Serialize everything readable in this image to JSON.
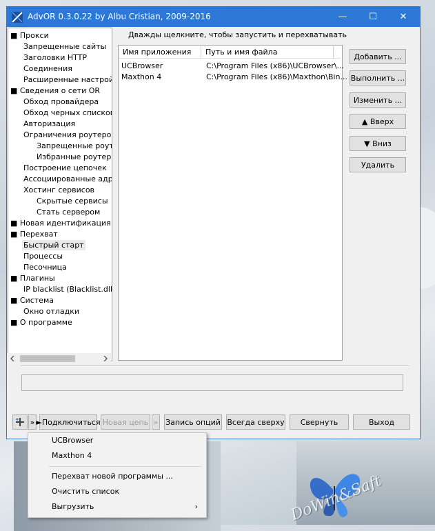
{
  "window": {
    "title": "AdvOR  0.3.0.22 by Albu Cristian, 2009-2016",
    "minimize": "—",
    "maximize": "☐",
    "close": "✕"
  },
  "tree": {
    "items": [
      {
        "label": "■ Прокси",
        "level": 0
      },
      {
        "label": "Запрещенные сайты",
        "level": 1
      },
      {
        "label": "Заголовки HTTP",
        "level": 1
      },
      {
        "label": "Соединения",
        "level": 1
      },
      {
        "label": "Расширенные настройки",
        "level": 1
      },
      {
        "label": "■ Сведения о сети OR",
        "level": 0
      },
      {
        "label": "Обход провайдера",
        "level": 1
      },
      {
        "label": "Обход черных списков T",
        "level": 1
      },
      {
        "label": "Авторизация",
        "level": 1
      },
      {
        "label": "Ограничения роутеров",
        "level": 1
      },
      {
        "label": "Запрещенные роутеры",
        "level": 2
      },
      {
        "label": "Избранные роутеры",
        "level": 2
      },
      {
        "label": "Построение цепочек",
        "level": 1
      },
      {
        "label": "Ассоциированные адреса",
        "level": 1
      },
      {
        "label": "Хостинг сервисов",
        "level": 1
      },
      {
        "label": "Скрытые сервисы",
        "level": 2
      },
      {
        "label": "Стать сервером",
        "level": 2
      },
      {
        "label": "■ Новая идентификация",
        "level": 0
      },
      {
        "label": "■ Перехват",
        "level": 0
      },
      {
        "label": "Быстрый старт",
        "level": 1,
        "selected": true
      },
      {
        "label": "Процессы",
        "level": 1
      },
      {
        "label": "Песочница",
        "level": 1
      },
      {
        "label": "■ Плагины",
        "level": 0
      },
      {
        "label": "IP blacklist (Blacklist.dll)",
        "level": 1
      },
      {
        "label": "■ Система",
        "level": 0
      },
      {
        "label": "Окно отладки",
        "level": 1
      },
      {
        "label": "■ О программе",
        "level": 0
      }
    ]
  },
  "main": {
    "hint": "Дважды щелкните, чтобы запустить и перехватывать",
    "columns": [
      "Имя приложения",
      "Путь и имя файла"
    ],
    "rows": [
      {
        "name": "UCBrowser",
        "path": "C:\\Program Files (x86)\\UCBrowser\\..."
      },
      {
        "name": "Maxthon 4",
        "path": "C:\\Program Files (x86)\\Maxthon\\Bin..."
      }
    ],
    "buttons": {
      "add": "Добавить ...",
      "run": "Выполнить ...",
      "edit": "Изменить ...",
      "up": "▲ Вверх",
      "down": "▼ Вниз",
      "delete": "Удалить"
    }
  },
  "bottom": {
    "more": "»",
    "connect": "►Подключиться",
    "new_chain": "Новая цепь",
    "more2": "»",
    "save": "Запись опций",
    "ontop": "Всегда сверху",
    "minimize": "Свернуть",
    "exit": "Выход"
  },
  "popup": {
    "items": [
      "UCBrowser",
      "Maxthon 4",
      "Перехват новой программы ...",
      "Очистить список",
      "Выгрузить"
    ],
    "submenu_arrow": "›"
  },
  "watermark": "DoWin&Saft",
  "colors": {
    "accent": "#2b78d6"
  }
}
